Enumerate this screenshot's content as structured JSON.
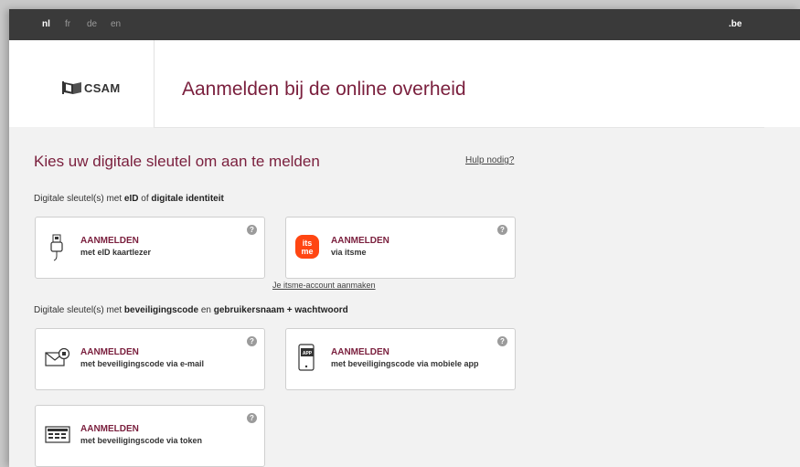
{
  "languages": [
    "nl",
    "fr",
    "de",
    "en"
  ],
  "top_right_logo": ".be",
  "header": {
    "logo_text": "CSAM",
    "title": "Aanmelden bij de online overheid"
  },
  "main": {
    "title": "Kies uw digitale sleutel om aan te melden",
    "help_link": "Hulp nodig?"
  },
  "section1": {
    "prefix": "Digitale sleutel(s) met ",
    "bold1": "eID",
    "mid": " of ",
    "bold2": "digitale identiteit"
  },
  "section2": {
    "prefix": "Digitale sleutel(s) met ",
    "bold1": "beveiligingscode",
    "mid": " en ",
    "bold2": "gebruikersnaam + wachtwoord"
  },
  "cards": {
    "eid": {
      "title": "AANMELDEN",
      "subtitle": "met eID kaartlezer",
      "help": "?"
    },
    "itsme": {
      "title": "AANMELDEN",
      "subtitle": "via itsme",
      "help": "?",
      "logo_text": "its me",
      "logo_color": "#ff4612"
    },
    "email": {
      "title": "AANMELDEN",
      "subtitle": "met beveiligingscode via e-mail",
      "help": "?"
    },
    "app": {
      "title": "AANMELDEN",
      "subtitle": "met beveiligingscode via mobiele app",
      "help": "?",
      "icon_label": "APP"
    },
    "token": {
      "title": "AANMELDEN",
      "subtitle": "met beveiligingscode via token",
      "help": "?"
    }
  },
  "itsme_account_link": "Je itsme-account aanmaken",
  "colors": {
    "accent": "#7a1f3d",
    "topbar": "#3a3a3a",
    "background": "#f2f2f2"
  }
}
